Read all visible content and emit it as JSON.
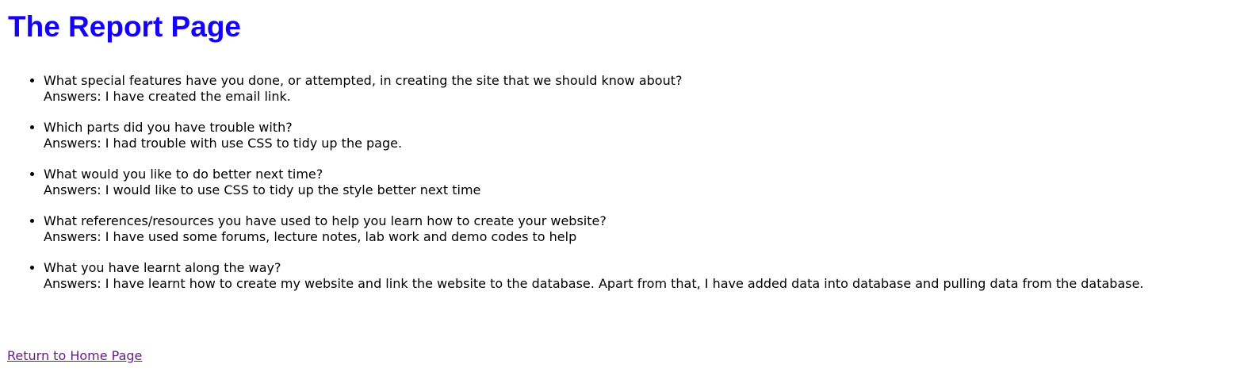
{
  "page": {
    "title": "The Report Page"
  },
  "report": {
    "items": [
      {
        "question": "What special features have you done, or attempted, in creating the site that we should know about?",
        "answer": "Answers: I have created the email link."
      },
      {
        "question": "Which parts did you have trouble with?",
        "answer": "Answers: I had trouble with use CSS to tidy up the page."
      },
      {
        "question": "What would you like to do better next time?",
        "answer": "Answers: I would like to use CSS to tidy up the style better next time"
      },
      {
        "question": "What references/resources you have used to help you learn how to create your website?",
        "answer": "Answers: I have used some forums, lecture notes, lab work and demo codes to help"
      },
      {
        "question": "What you have learnt along the way?",
        "answer": "Answers: I have learnt how to create my website and link the website to the database. Apart from that, I have added data into database and pulling data from the database."
      }
    ]
  },
  "footer": {
    "home_link_label": "Return to Home Page"
  },
  "colors": {
    "title": "#1400ff",
    "visited_link": "#6a1b8a",
    "text": "#000000",
    "background": "#ffffff"
  }
}
